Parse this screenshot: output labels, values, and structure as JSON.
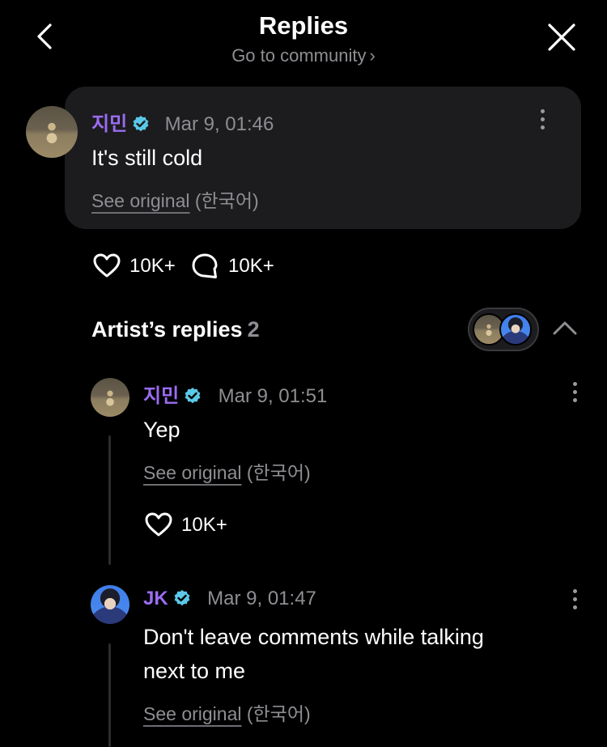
{
  "header": {
    "title": "Replies",
    "subtitle": "Go to community",
    "subtitle_chevron": "›"
  },
  "post": {
    "author": "지민",
    "time": "Mar 9, 01:46",
    "text": "It's still cold",
    "see_original": "See original",
    "language": "(한국어)",
    "likes": "10K+",
    "comments": "10K+"
  },
  "artist_replies": {
    "title": "Artist’s replies",
    "count": "2",
    "replies": [
      {
        "author": "지민",
        "time": "Mar 9, 01:51",
        "text": "Yep",
        "see_original": "See original",
        "language": "(한국어)",
        "likes": "10K+"
      },
      {
        "author": "JK",
        "time": "Mar 9, 01:47",
        "text_line1": "Don't leave comments while talking",
        "text_line2": "next to me",
        "see_original": "See original",
        "language": "(한국어)"
      }
    ]
  },
  "colors": {
    "background": "#000000",
    "card": "#1c1c1e",
    "author_name": "#9b6cf2",
    "verified_badge": "#5ac8e8",
    "muted": "#8e8e93"
  },
  "icons": [
    "back-icon",
    "close-icon",
    "verified-icon",
    "more-icon",
    "heart-icon",
    "comment-icon",
    "chevron-up-icon"
  ]
}
